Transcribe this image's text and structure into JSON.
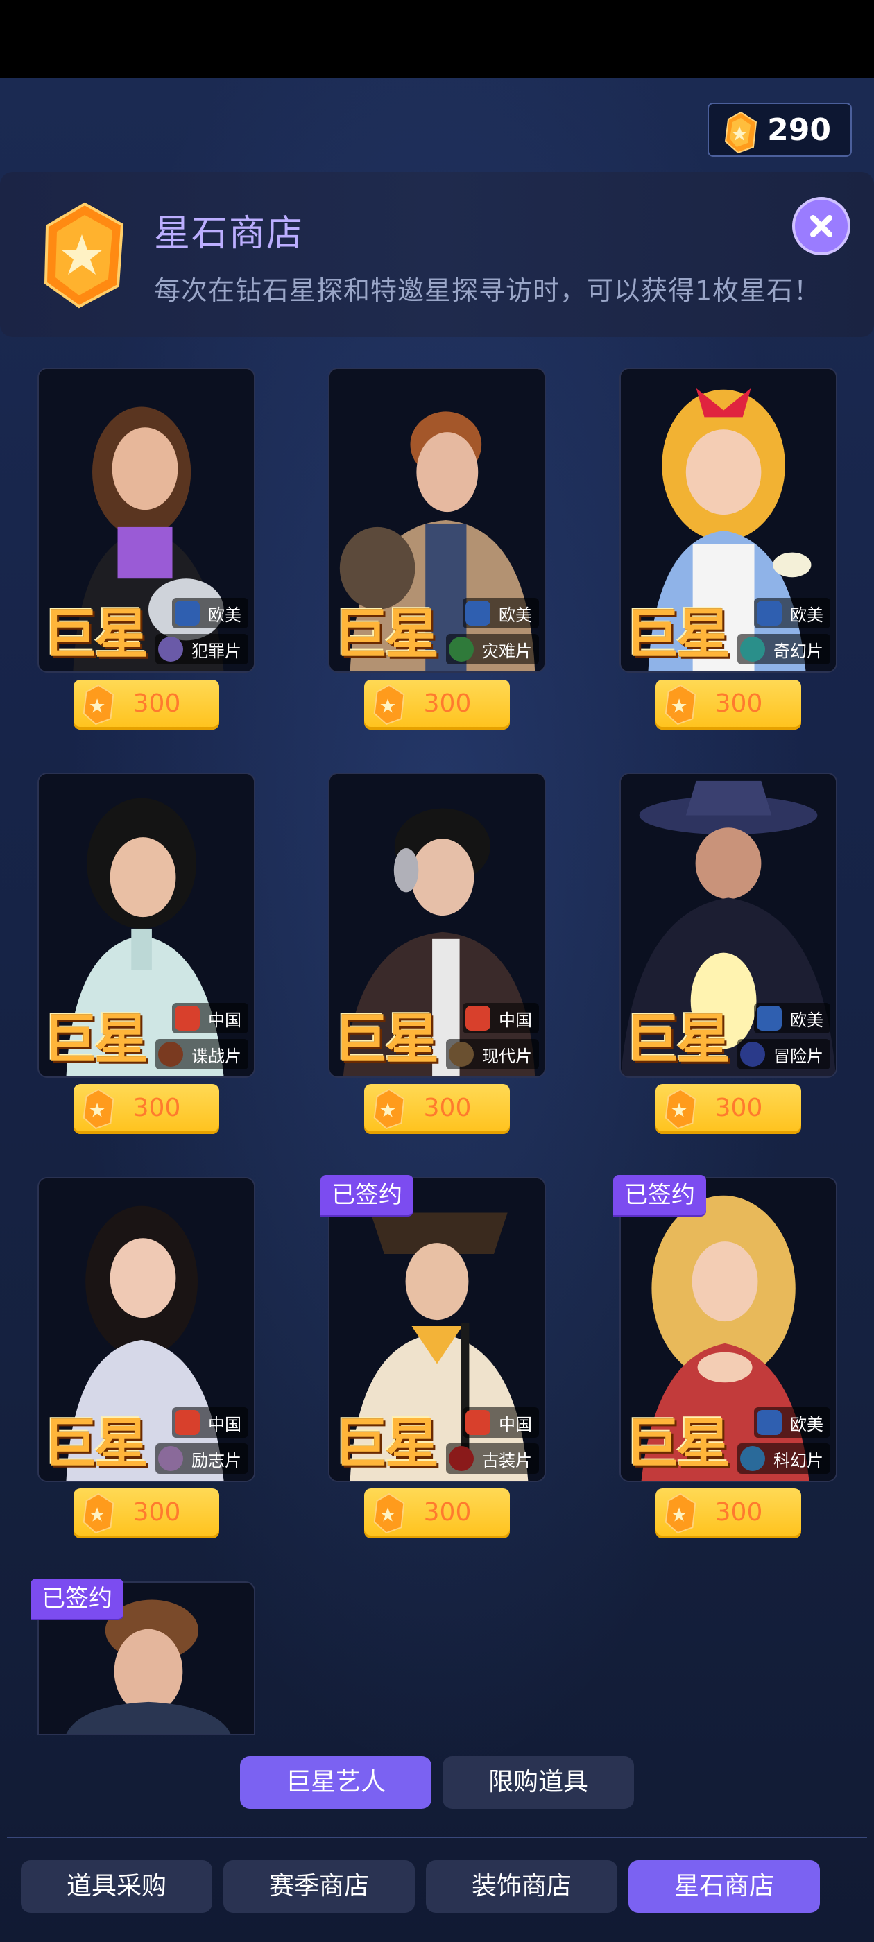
{
  "currency": {
    "icon": "star-gem-icon",
    "amount": "290"
  },
  "shop": {
    "title": "星石商店",
    "description": "每次在钻石星探和特邀星探寻访时，可以获得1枚星石！",
    "close_icon": "close-icon"
  },
  "cards": [
    {
      "rank": "巨星",
      "region": "欧美",
      "genre": "犯罪片",
      "price": "300",
      "signed": false
    },
    {
      "rank": "巨星",
      "region": "欧美",
      "genre": "灾难片",
      "price": "300",
      "signed": false
    },
    {
      "rank": "巨星",
      "region": "欧美",
      "genre": "奇幻片",
      "price": "300",
      "signed": false
    },
    {
      "rank": "巨星",
      "region": "中国",
      "genre": "谍战片",
      "price": "300",
      "signed": false
    },
    {
      "rank": "巨星",
      "region": "中国",
      "genre": "现代片",
      "price": "300",
      "signed": false
    },
    {
      "rank": "巨星",
      "region": "欧美",
      "genre": "冒险片",
      "price": "300",
      "signed": false
    },
    {
      "rank": "巨星",
      "region": "中国",
      "genre": "励志片",
      "price": "300",
      "signed": false
    },
    {
      "rank": "巨星",
      "region": "中国",
      "genre": "古装片",
      "price": "300",
      "signed": true
    },
    {
      "rank": "巨星",
      "region": "欧美",
      "genre": "科幻片",
      "price": "300",
      "signed": true
    },
    {
      "rank": "",
      "region": "",
      "genre": "",
      "price": "",
      "signed": true
    }
  ],
  "signed_label": "已签约",
  "sub_tabs": [
    {
      "label": "巨星艺人",
      "active": true
    },
    {
      "label": "限购道具",
      "active": false
    }
  ],
  "bottom_tabs": [
    {
      "label": "道具采购",
      "active": false
    },
    {
      "label": "赛季商店",
      "active": false
    },
    {
      "label": "装饰商店",
      "active": false
    },
    {
      "label": "星石商店",
      "active": true
    }
  ],
  "colors": {
    "accent": "#7b62f2",
    "price_button": "#ffc21c",
    "price_text": "#ff7a2e",
    "signed_badge": "#7c4cf0",
    "rank_label": "#ffb53a"
  }
}
